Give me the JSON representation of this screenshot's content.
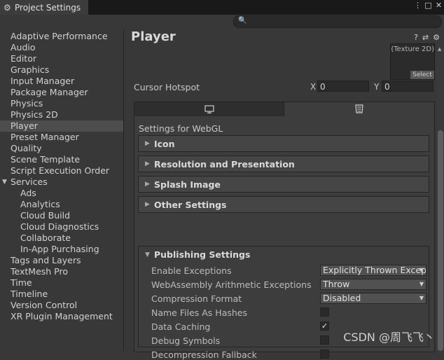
{
  "window": {
    "title": "Project Settings"
  },
  "sidebar": {
    "items": [
      {
        "label": "Adaptive Performance",
        "indent": 0
      },
      {
        "label": "Audio",
        "indent": 0
      },
      {
        "label": "Editor",
        "indent": 0
      },
      {
        "label": "Graphics",
        "indent": 0
      },
      {
        "label": "Input Manager",
        "indent": 0
      },
      {
        "label": "Package Manager",
        "indent": 0
      },
      {
        "label": "Physics",
        "indent": 0
      },
      {
        "label": "Physics 2D",
        "indent": 0
      },
      {
        "label": "Player",
        "indent": 0,
        "selected": true
      },
      {
        "label": "Preset Manager",
        "indent": 0
      },
      {
        "label": "Quality",
        "indent": 0
      },
      {
        "label": "Scene Template",
        "indent": 0
      },
      {
        "label": "Script Execution Order",
        "indent": 0
      },
      {
        "label": "Services",
        "indent": 0,
        "foldout": true
      },
      {
        "label": "Ads",
        "indent": 1
      },
      {
        "label": "Analytics",
        "indent": 1
      },
      {
        "label": "Cloud Build",
        "indent": 1
      },
      {
        "label": "Cloud Diagnostics",
        "indent": 1
      },
      {
        "label": "Collaborate",
        "indent": 1
      },
      {
        "label": "In-App Purchasing",
        "indent": 1
      },
      {
        "label": "Tags and Layers",
        "indent": 0
      },
      {
        "label": "TextMesh Pro",
        "indent": 0
      },
      {
        "label": "Time",
        "indent": 0
      },
      {
        "label": "Timeline",
        "indent": 0
      },
      {
        "label": "Version Control",
        "indent": 0
      },
      {
        "label": "XR Plugin Management",
        "indent": 0
      }
    ]
  },
  "main": {
    "title": "Player",
    "texture": {
      "name": "(Texture 2D)",
      "select_label": "Select"
    },
    "cursor_hotspot": {
      "label": "Cursor Hotspot",
      "x_label": "X",
      "x_value": "0",
      "y_label": "Y",
      "y_value": "0"
    },
    "settings_for": "Settings for WebGL",
    "sections": [
      "Icon",
      "Resolution and Presentation",
      "Splash Image",
      "Other Settings"
    ],
    "publishing": {
      "title": "Publishing Settings",
      "enable_exceptions": {
        "label": "Enable Exceptions",
        "value": "Explicitly Thrown Exceptions Only"
      },
      "wasm_arith": {
        "label": "WebAssembly Arithmetic Exceptions",
        "value": "Throw"
      },
      "compression": {
        "label": "Compression Format",
        "value": "Disabled"
      },
      "name_files": {
        "label": "Name Files As Hashes",
        "checked": false
      },
      "data_caching": {
        "label": "Data Caching",
        "checked": true
      },
      "debug_symbols": {
        "label": "Debug Symbols",
        "checked": false
      },
      "decomp_fallback": {
        "label": "Decompression Fallback",
        "checked": false
      }
    }
  },
  "watermark": "CSDN @周飞飞丶"
}
